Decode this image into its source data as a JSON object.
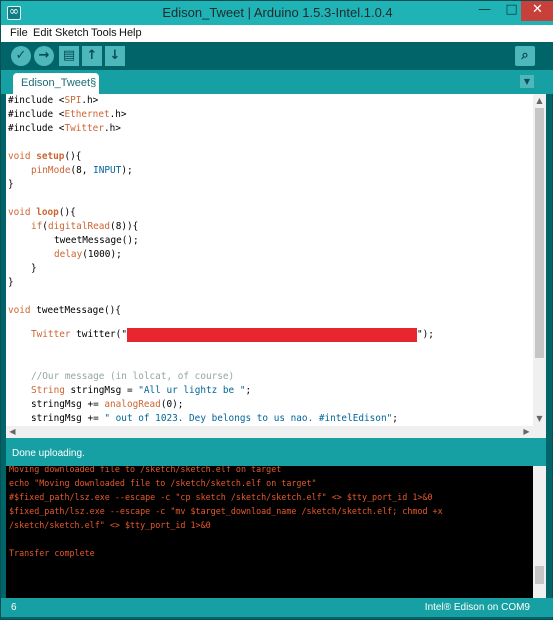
{
  "window": {
    "title": "Edison_Tweet | Arduino 1.5.3-Intel.1.0.4",
    "app_icon": "arduino-logo-icon",
    "minimize_glyph": "—",
    "maximize_glyph": "□",
    "close_glyph": "✕"
  },
  "menu": {
    "items": [
      "File",
      "Edit",
      "Sketch",
      "Tools",
      "Help"
    ]
  },
  "toolbar": {
    "verify": "✓",
    "upload": "→",
    "new": "▤",
    "open": "↑",
    "save": "↓",
    "serial_monitor": "⌕"
  },
  "tabs": {
    "active": "Edison_Tweet§",
    "menu_glyph": "▼"
  },
  "editor": {
    "lines": {
      "l1": {
        "a": "#include <",
        "b": "SPI",
        "c": ".h>"
      },
      "l2": {
        "a": "#include <",
        "b": "Ethernet",
        "c": ".h>"
      },
      "l3": {
        "a": "#include <",
        "b": "Twitter",
        "c": ".h>"
      },
      "l5": {
        "a": "void ",
        "b": "setup",
        "c": "(){"
      },
      "l6": {
        "a": "pinMode",
        "b": "(8, ",
        "c": "INPUT",
        "d": ");"
      },
      "l7": "}",
      "l9": {
        "a": "void ",
        "b": "loop",
        "c": "(){"
      },
      "l10": {
        "a": "if",
        "b": "(",
        "c": "digitalRead",
        "d": "(8)){"
      },
      "l11": "tweetMessage();",
      "l12": {
        "a": "delay",
        "b": "(1000);"
      },
      "l13": "}",
      "l14": "}",
      "l16": {
        "a": "void ",
        "b": "tweetMessage(){"
      },
      "l18": {
        "a": "Twitter",
        "b": " twitter(\"",
        "c": "\");"
      },
      "l21": "//Our message (in lolcat, of course)",
      "l22": {
        "a": "String",
        "b": " stringMsg = ",
        "c": "\"All ur lightz be \"",
        "d": ";"
      },
      "l23": {
        "a": "stringMsg += ",
        "b": "analogRead",
        "c": "(0);"
      },
      "l24": {
        "a": "stringMsg += ",
        "b": "\" out of 1023. Dey belongs to us nao. #intelEdison\"",
        "c": ";"
      }
    },
    "redacted": true
  },
  "status": {
    "message": "Done uploading."
  },
  "console": {
    "lines": [
      "Moving downloaded file to /sketch/sketch.elf on target",
      "echo \"Moving downloaded file to /sketch/sketch.elf on target\"",
      "#$fixed_path/lsz.exe --escape -c \"cp sketch /sketch/sketch.elf\" <> $tty_port_id 1>&0",
      "$fixed_path/lsz.exe --escape -c \"mv $target_download_name /sketch/sketch.elf; chmod +x",
      "/sketch/sketch.elf\" <> $tty_port_id 1>&0",
      "",
      "Transfer complete"
    ]
  },
  "footer": {
    "line_number": "6",
    "board": "Intel® Edison on COM9"
  },
  "colors": {
    "window_teal": "#006468",
    "titlebar": "#1fb3b6",
    "keyword_orange": "#cc6633",
    "keyword_blue": "#006699",
    "console_text": "#e7592b",
    "redaction": "#e8262f"
  }
}
